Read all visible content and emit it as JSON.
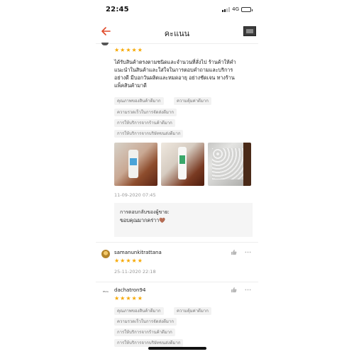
{
  "status_bar": {
    "time": "22:45",
    "network": "4G",
    "battery_level": 0.85
  },
  "nav": {
    "title": "คะแนน",
    "back_icon": "back-arrow-icon",
    "thumb_icon": "product-thumbnail"
  },
  "review_top": {
    "rating": 5,
    "text_lines": [
      "ได้รับสินค้าตรงตามชนิดและจำนวนที่สั่งไป ร้านค้าให้คำ",
      "แนะนำในสินค้าและใส่ใจในการตอบคำถามและบริการ",
      "อย่างดี มีบอกวันผลิตและหมดอายุ อย่างชัดเจน ทางร้าน",
      "แพ็คสินค้ามาดี"
    ],
    "chips": [
      "คุณภาพของสินค้าดีมาก",
      "ความคุ้มค่าดีมาก",
      "ความรวดเร็วในการจัดส่งดีมาก",
      "การให้บริการจากร้านค้าดีมาก",
      "การให้บริการจากบริษัทขนส่งดีมาก"
    ],
    "timestamp": "11-09-2020 07:45",
    "reply_title": "การตอบกลับของผู้ขาย:",
    "reply_text": "ขอบคุณมากคร่าา🤎"
  },
  "review_2": {
    "username": "samanunkitrattana",
    "rating": 5,
    "timestamp": "25-11-2020 22:18"
  },
  "review_3": {
    "username": "dachatron94",
    "avatar_text": "P.S.Cu",
    "rating": 5,
    "chips": [
      "คุณภาพของสินค้าดีมาก",
      "ความคุ้มค่าดีมาก",
      "ความรวดเร็วในการจัดส่งดีมาก",
      "การให้บริการจากร้านค้าดีมาก",
      "การให้บริการจากบริษัทขนส่งดีมาก"
    ]
  },
  "colors": {
    "star": "#f6a700",
    "back_arrow": "#e04a2a",
    "chip_bg": "#f2f2f2",
    "reply_title": "#333333"
  }
}
